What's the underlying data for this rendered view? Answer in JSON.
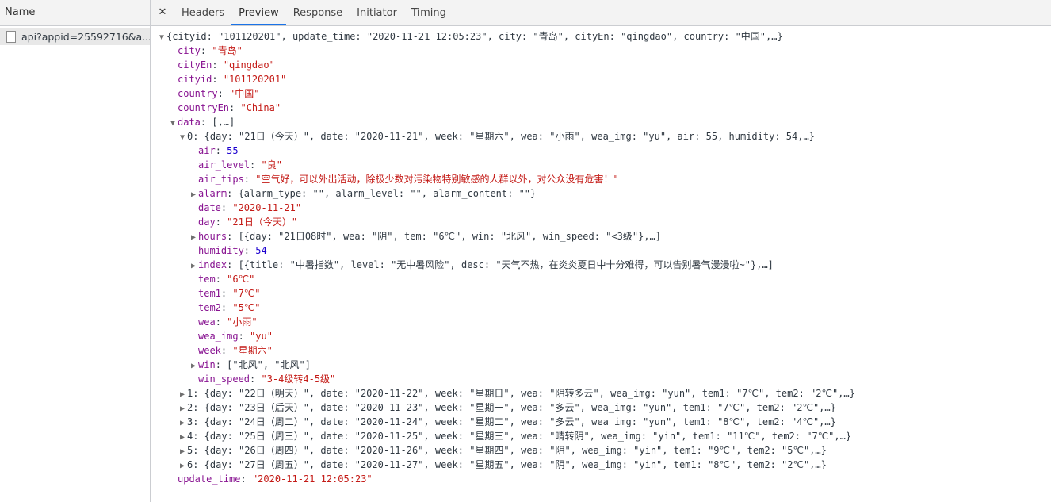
{
  "left": {
    "header": "Name",
    "request": "api?appid=25592716&a..."
  },
  "tabs": [
    "Headers",
    "Preview",
    "Response",
    "Initiator",
    "Timing"
  ],
  "tree": {
    "summary": "{cityid: \"101120201\", update_time: \"2020-11-21 12:05:23\", city: \"青岛\", cityEn: \"qingdao\", country: \"中国\",…}",
    "city": {
      "key": "city",
      "value": "\"青岛\""
    },
    "cityEn": {
      "key": "cityEn",
      "value": "\"qingdao\""
    },
    "cityid": {
      "key": "cityid",
      "value": "\"101120201\""
    },
    "country": {
      "key": "country",
      "value": "\"中国\""
    },
    "countryEn": {
      "key": "countryEn",
      "value": "\"China\""
    },
    "data": {
      "key": "data",
      "value": "[,…]"
    },
    "item0": {
      "summary": "0: {day: \"21日（今天）\", date: \"2020-11-21\", week: \"星期六\", wea: \"小雨\", wea_img: \"yu\", air: 55, humidity: 54,…}",
      "air": {
        "key": "air",
        "value": "55"
      },
      "air_level": {
        "key": "air_level",
        "value": "\"良\""
      },
      "air_tips": {
        "key": "air_tips",
        "value": "\"空气好，可以外出活动，除极少数对污染物特别敏感的人群以外，对公众没有危害！\""
      },
      "alarm": {
        "key": "alarm",
        "value": "{alarm_type: \"\", alarm_level: \"\", alarm_content: \"\"}"
      },
      "date": {
        "key": "date",
        "value": "\"2020-11-21\""
      },
      "day": {
        "key": "day",
        "value": "\"21日（今天）\""
      },
      "hours": {
        "key": "hours",
        "value": "[{day: \"21日08时\", wea: \"阴\", tem: \"6℃\", win: \"北风\", win_speed: \"<3级\"},…]"
      },
      "humidity": {
        "key": "humidity",
        "value": "54"
      },
      "index": {
        "key": "index",
        "value": "[{title: \"中暑指数\", level: \"无中暑风险\", desc: \"天气不热，在炎炎夏日中十分难得，可以告别暑气漫漫啦~\"},…]"
      },
      "tem": {
        "key": "tem",
        "value": "\"6℃\""
      },
      "tem1": {
        "key": "tem1",
        "value": "\"7℃\""
      },
      "tem2": {
        "key": "tem2",
        "value": "\"5℃\""
      },
      "wea": {
        "key": "wea",
        "value": "\"小雨\""
      },
      "wea_img": {
        "key": "wea_img",
        "value": "\"yu\""
      },
      "week": {
        "key": "week",
        "value": "\"星期六\""
      },
      "win": {
        "key": "win",
        "value": "[\"北风\", \"北风\"]"
      },
      "win_speed": {
        "key": "win_speed",
        "value": "\"3-4级转4-5级\""
      }
    },
    "items": [
      "1: {day: \"22日（明天）\", date: \"2020-11-22\", week: \"星期日\", wea: \"阴转多云\", wea_img: \"yun\", tem1: \"7℃\", tem2: \"2℃\",…}",
      "2: {day: \"23日（后天）\", date: \"2020-11-23\", week: \"星期一\", wea: \"多云\", wea_img: \"yun\", tem1: \"7℃\", tem2: \"2℃\",…}",
      "3: {day: \"24日（周二）\", date: \"2020-11-24\", week: \"星期二\", wea: \"多云\", wea_img: \"yun\", tem1: \"8℃\", tem2: \"4℃\",…}",
      "4: {day: \"25日（周三）\", date: \"2020-11-25\", week: \"星期三\", wea: \"晴转阴\", wea_img: \"yin\", tem1: \"11℃\", tem2: \"7℃\",…}",
      "5: {day: \"26日（周四）\", date: \"2020-11-26\", week: \"星期四\", wea: \"阴\", wea_img: \"yin\", tem1: \"9℃\", tem2: \"5℃\",…}",
      "6: {day: \"27日（周五）\", date: \"2020-11-27\", week: \"星期五\", wea: \"阴\", wea_img: \"yin\", tem1: \"8℃\", tem2: \"2℃\",…}"
    ],
    "update_time": {
      "key": "update_time",
      "value": "\"2020-11-21 12:05:23\""
    }
  },
  "icons": {
    "close": "close-icon",
    "expanded": "triangle-down-icon",
    "collapsed": "triangle-right-icon",
    "file": "file-icon"
  },
  "colors": {
    "key": "#881391",
    "string": "#c41a16",
    "number": "#1c00cf",
    "active_tab_underline": "#1a73e8"
  }
}
